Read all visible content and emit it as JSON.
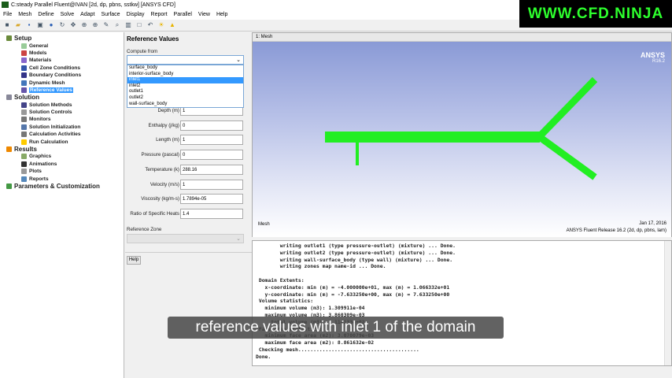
{
  "window": {
    "title": "C:steady Parallel Fluent@IVAN  [2d, dp, pbns, sstkw] [ANSYS CFD]"
  },
  "menu": [
    "File",
    "Mesh",
    "Define",
    "Solve",
    "Adapt",
    "Surface",
    "Display",
    "Report",
    "Parallel",
    "View",
    "Help"
  ],
  "watermark": "WWW.CFD.NINJA",
  "tree": [
    {
      "label": "Setup",
      "level": 0,
      "color": "#6a8a3a"
    },
    {
      "label": "General",
      "level": 1,
      "color": "#9c9"
    },
    {
      "label": "Models",
      "level": 1,
      "color": "#c44"
    },
    {
      "label": "Materials",
      "level": 1,
      "color": "#86c"
    },
    {
      "label": "Cell Zone Conditions",
      "level": 1,
      "color": "#35a"
    },
    {
      "label": "Boundary Conditions",
      "level": 1,
      "color": "#338"
    },
    {
      "label": "Dynamic Mesh",
      "level": 1,
      "color": "#47b"
    },
    {
      "label": "Reference Values",
      "level": 1,
      "color": "#65a",
      "selected": true
    },
    {
      "label": "Solution",
      "level": 0,
      "color": "#889"
    },
    {
      "label": "Solution Methods",
      "level": 1,
      "color": "#448"
    },
    {
      "label": "Solution Controls",
      "level": 1,
      "color": "#999"
    },
    {
      "label": "Monitors",
      "level": 1,
      "color": "#777"
    },
    {
      "label": "Solution Initialization",
      "level": 1,
      "color": "#57a"
    },
    {
      "label": "Calculation Activities",
      "level": 1,
      "color": "#777"
    },
    {
      "label": "Run Calculation",
      "level": 1,
      "color": "#fc0"
    },
    {
      "label": "Results",
      "level": 0,
      "color": "#e80"
    },
    {
      "label": "Graphics",
      "level": 1,
      "color": "#8a6"
    },
    {
      "label": "Animations",
      "level": 1,
      "color": "#333"
    },
    {
      "label": "Plots",
      "level": 1,
      "color": "#999"
    },
    {
      "label": "Reports",
      "level": 1,
      "color": "#58b"
    },
    {
      "label": "Parameters & Customization",
      "level": 0,
      "color": "#494"
    }
  ],
  "task": {
    "title": "Reference Values",
    "compute_from_label": "Compute from",
    "compute_from_value": "",
    "options": [
      "surface_body",
      "interior-surface_body",
      "inlet1",
      "inlet2",
      "outlet1",
      "outlet2",
      "wall-surface_body"
    ],
    "highlighted_option": "inlet1",
    "fields": [
      {
        "label": "Depth (m)",
        "value": "1"
      },
      {
        "label": "Enthalpy (j/kg)",
        "value": "0"
      },
      {
        "label": "Length (m)",
        "value": "1"
      },
      {
        "label": "Pressure (pascal)",
        "value": "0"
      },
      {
        "label": "Temperature (k)",
        "value": "288.16"
      },
      {
        "label": "Velocity (m/s)",
        "value": "1"
      },
      {
        "label": "Viscosity (kg/m-s)",
        "value": "1.7894e-05"
      },
      {
        "label": "Ratio of Specific Heats",
        "value": "1.4"
      }
    ],
    "reference_zone_label": "Reference Zone",
    "help_label": "Help"
  },
  "graphics": {
    "tab": "1: Mesh",
    "brand": "ANSYS",
    "version": "R16.2",
    "caption": "Mesh",
    "date": "Jan 17, 2016",
    "release": "ANSYS Fluent Release 16.2 (2d, dp, pbns, lam)",
    "mesh_color": "#22ee22"
  },
  "console": "        writing outlet1 (type pressure-outlet) (mixture) ... Done.\n        writing outlet2 (type pressure-outlet) (mixture) ... Done.\n        writing wall-surface_body (type wall) (mixture) ... Done.\n        writing zones map name-id ... Done.\n\n Domain Extents:\n   x-coordinate: min (m) = -4.000000e+01, max (m) = 1.066332e+01\n   y-coordinate: min (m) = -7.633250e+00, max (m) = 7.633250e+00\n Volume statistics:\n   minimum volume (m3): 1.309911e-04\n   maximum volume (m3): 3.860309e-03\n     total volume (m3): 1.114133e+02\n Face area statistics:\n   minimum face area (m2): 3.070079e-03\n   maximum face area (m2): 8.861632e-02\n Checking mesh........................................\nDone.",
  "subtitle": "reference values with inlet 1 of the domain"
}
